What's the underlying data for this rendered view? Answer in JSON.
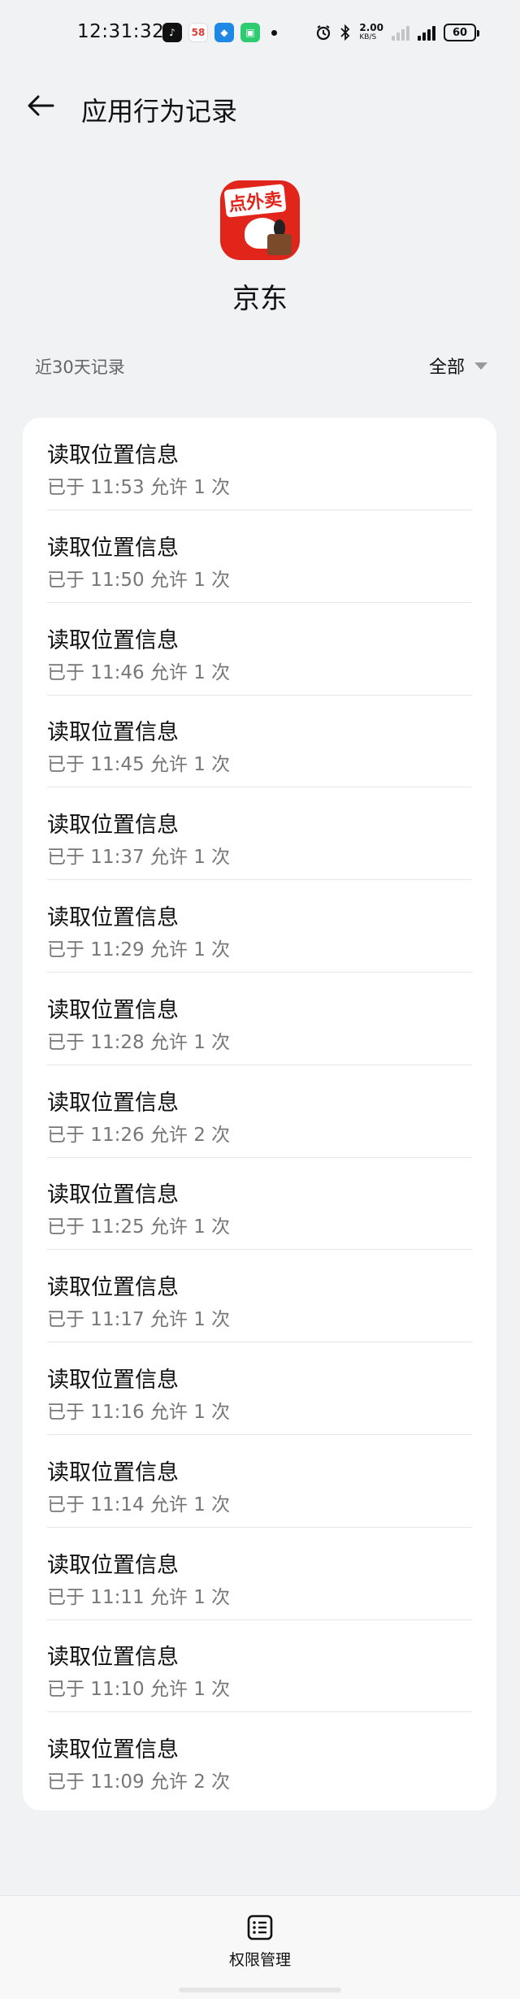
{
  "status_bar": {
    "time": "12:31:32",
    "notif_58": "58",
    "speed_value": "2.00",
    "speed_unit": "KB/S",
    "battery": "60"
  },
  "header": {
    "title": "应用行为记录"
  },
  "app": {
    "name": "京东",
    "icon_tag": "点外卖"
  },
  "filter": {
    "range_label": "近30天记录",
    "selected": "全部"
  },
  "records": [
    {
      "title": "读取位置信息",
      "detail": "已于 11:53 允许 1 次"
    },
    {
      "title": "读取位置信息",
      "detail": "已于 11:50 允许 1 次"
    },
    {
      "title": "读取位置信息",
      "detail": "已于 11:46 允许 1 次"
    },
    {
      "title": "读取位置信息",
      "detail": "已于 11:45 允许 1 次"
    },
    {
      "title": "读取位置信息",
      "detail": "已于 11:37 允许 1 次"
    },
    {
      "title": "读取位置信息",
      "detail": "已于 11:29 允许 1 次"
    },
    {
      "title": "读取位置信息",
      "detail": "已于 11:28 允许 1 次"
    },
    {
      "title": "读取位置信息",
      "detail": "已于 11:26 允许 2 次"
    },
    {
      "title": "读取位置信息",
      "detail": "已于 11:25 允许 1 次"
    },
    {
      "title": "读取位置信息",
      "detail": "已于 11:17 允许 1 次"
    },
    {
      "title": "读取位置信息",
      "detail": "已于 11:16 允许 1 次"
    },
    {
      "title": "读取位置信息",
      "detail": "已于 11:14 允许 1 次"
    },
    {
      "title": "读取位置信息",
      "detail": "已于 11:11 允许 1 次"
    },
    {
      "title": "读取位置信息",
      "detail": "已于 11:10 允许 1 次"
    },
    {
      "title": "读取位置信息",
      "detail": "已于 11:09 允许 2 次"
    }
  ],
  "bottom_bar": {
    "permission_label": "权限管理"
  },
  "icons": {
    "back": "arrow-left-icon",
    "filter": "caret-down-icon",
    "permission": "list-icon"
  }
}
